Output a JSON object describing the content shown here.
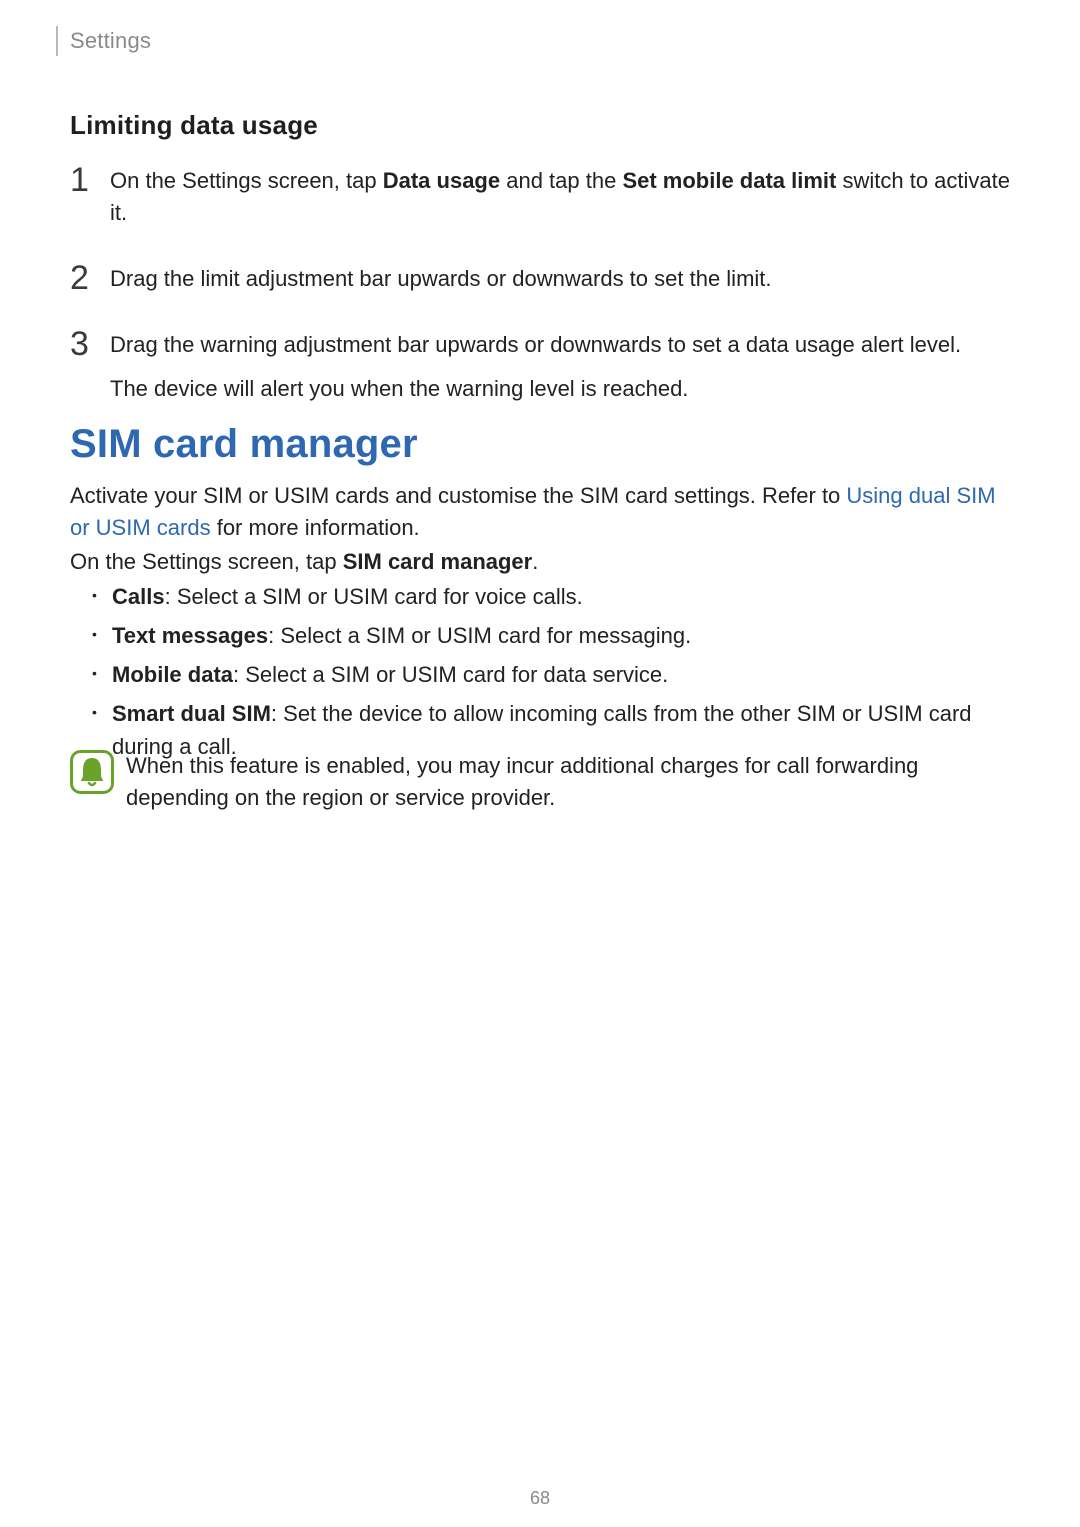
{
  "header": {
    "section": "Settings"
  },
  "limiting": {
    "heading": "Limiting data usage",
    "steps": [
      {
        "num": "1",
        "parts": [
          {
            "t": "On the Settings screen, tap "
          },
          {
            "t": "Data usage",
            "b": true
          },
          {
            "t": " and tap the "
          },
          {
            "t": "Set mobile data limit",
            "b": true
          },
          {
            "t": " switch to activate it."
          }
        ]
      },
      {
        "num": "2",
        "parts": [
          {
            "t": "Drag the limit adjustment bar upwards or downwards to set the limit."
          }
        ]
      },
      {
        "num": "3",
        "parts": [
          {
            "t": "Drag the warning adjustment bar upwards or downwards to set a data usage alert level."
          }
        ],
        "extra": "The device will alert you when the warning level is reached."
      }
    ]
  },
  "sim": {
    "heading": "SIM card manager",
    "intro_parts": [
      {
        "t": "Activate your SIM or USIM cards and customise the SIM card settings. Refer to "
      },
      {
        "t": "Using dual SIM or USIM cards",
        "link": true
      },
      {
        "t": " for more information."
      }
    ],
    "instruction_parts": [
      {
        "t": "On the Settings screen, tap "
      },
      {
        "t": "SIM card manager",
        "b": true
      },
      {
        "t": "."
      }
    ],
    "bullets": [
      {
        "label": "Calls",
        "desc": ": Select a SIM or USIM card for voice calls."
      },
      {
        "label": "Text messages",
        "desc": ": Select a SIM or USIM card for messaging."
      },
      {
        "label": "Mobile data",
        "desc": ": Select a SIM or USIM card for data service."
      },
      {
        "label": "Smart dual SIM",
        "desc": ": Set the device to allow incoming calls from the other SIM or USIM card during a call."
      }
    ],
    "note": "When this feature is enabled, you may incur additional charges for call forwarding depending on the region or service provider."
  },
  "page_number": "68"
}
